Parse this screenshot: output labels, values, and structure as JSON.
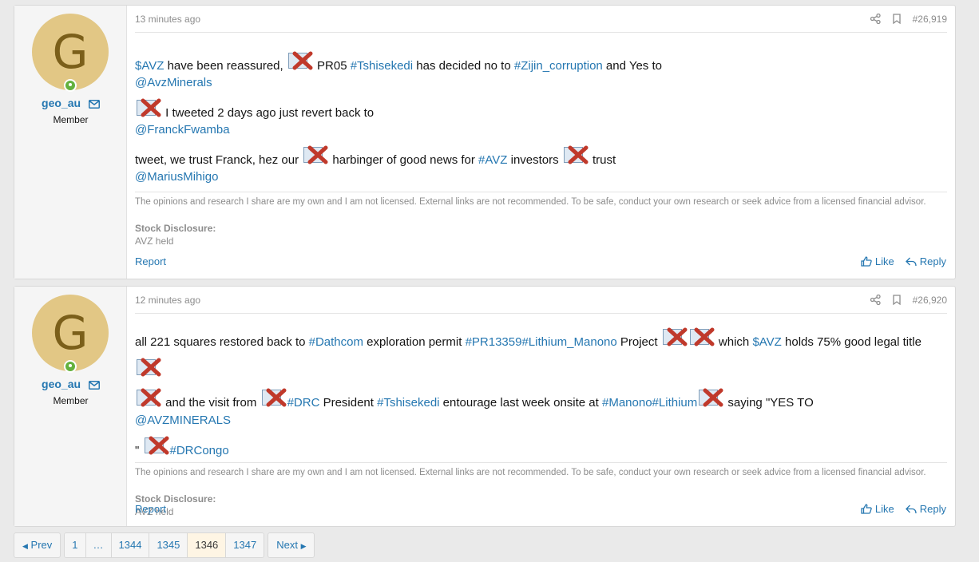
{
  "posts": [
    {
      "user": {
        "initial": "G",
        "name": "geo_au",
        "title": "Member"
      },
      "time": "13 minutes ago",
      "number": "#26,919",
      "p1": {
        "a": "$AVZ",
        "b": " have been reassured, ",
        "c": " PR05 ",
        "d": "#Tshisekedi",
        "e": " has decided no to ",
        "f": "#Zijin_corruption",
        "g": " and Yes to",
        "h": "@AvzMinerals"
      },
      "p2": {
        "a": " I tweeted 2 days ago just revert back to",
        "b": "@FranckFwamba"
      },
      "p3": {
        "a": "tweet, we trust Franck, hez our ",
        "b": " harbinger of good news for ",
        "c": "#AVZ",
        "d": " investors ",
        "e": " trust",
        "f": "@MariusMihigo"
      },
      "disclaimer": "The opinions and research I share are my own and I am not licensed. External links are not recommended. To be safe, conduct your own research or seek advice from a licensed financial advisor.",
      "disclosure_label": "Stock Disclosure:",
      "disclosure_value": "AVZ held",
      "report": "Report",
      "like": "Like",
      "reply": "Reply"
    },
    {
      "user": {
        "initial": "G",
        "name": "geo_au",
        "title": "Member"
      },
      "time": "12 minutes ago",
      "number": "#26,920",
      "p1": {
        "a": "all 221 squares restored back to ",
        "b": "#Dathcom",
        "c": " exploration permit ",
        "d": "#PR13359",
        "e": "#Lithium_Manono",
        "f": " Project ",
        "g": " which ",
        "h": "$AVZ",
        "i": " holds 75% good legal title "
      },
      "p2": {
        "a": " and the visit from ",
        "b": "#DRC",
        "c": " President ",
        "d": "#Tshisekedi",
        "e": " entourage last week onsite at ",
        "f": "#Manono",
        "g": "#Lithium",
        "h": " saying \"YES TO",
        "i": "@AVZMINERALS"
      },
      "p3": {
        "a": "\" ",
        "b": "#DRCongo"
      },
      "disclaimer": "The opinions and research I share are my own and I am not licensed. External links are not recommended. To be safe, conduct your own research or seek advice from a licensed financial advisor.",
      "disclosure_label": "Stock Disclosure:",
      "disclosure_value": "AVZ held",
      "report": "Report",
      "like": "Like",
      "reply": "Reply"
    }
  ],
  "pagination": {
    "prev": "Prev",
    "pages": [
      "1",
      "…",
      "1344",
      "1345",
      "1346",
      "1347"
    ],
    "current": "1346",
    "next": "Next"
  },
  "icons": {
    "share": "share-icon",
    "bookmark": "bookmark-icon",
    "mail": "envelope-icon",
    "like": "thumbs-up-icon",
    "reply": "reply-arrow-icon",
    "broken_image": "broken-image-icon"
  },
  "colors": {
    "link": "#2577b1",
    "avatar_bg": "#e2c785",
    "online": "#63b13e",
    "current_page": "#fef5e4"
  }
}
